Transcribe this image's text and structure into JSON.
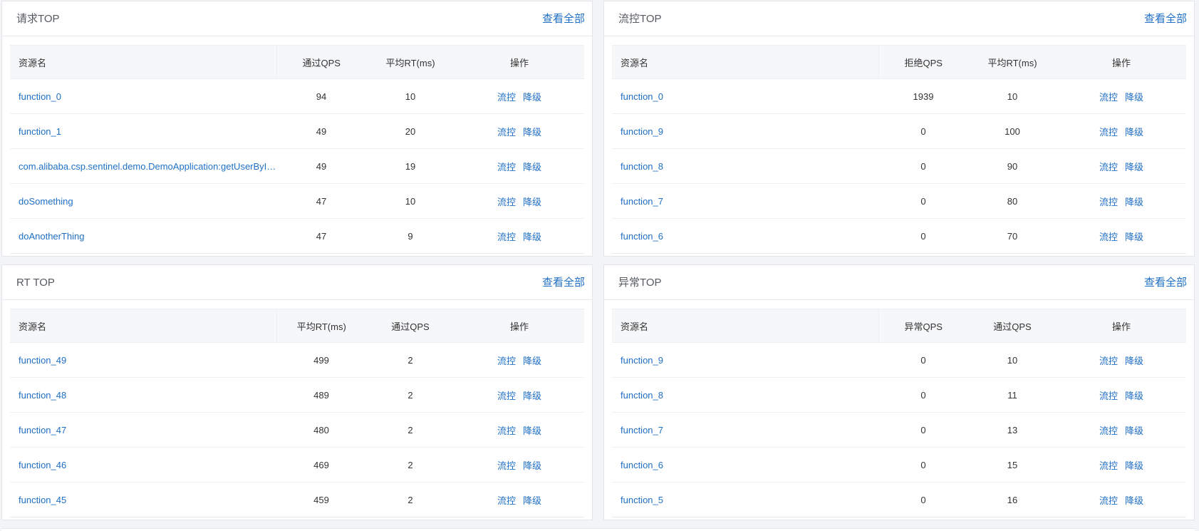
{
  "panels": [
    {
      "title": "请求TOP",
      "view_all": "查看全部",
      "columns": [
        "资源名",
        "通过QPS",
        "平均RT(ms)",
        "操作"
      ],
      "rows": [
        {
          "name": "function_0",
          "c1": "94",
          "c2": "10"
        },
        {
          "name": "function_1",
          "c1": "49",
          "c2": "20"
        },
        {
          "name": "com.alibaba.csp.sentinel.demo.DemoApplication:getUserById(java.l...",
          "c1": "49",
          "c2": "19"
        },
        {
          "name": "doSomething",
          "c1": "47",
          "c2": "10"
        },
        {
          "name": "doAnotherThing",
          "c1": "47",
          "c2": "9"
        }
      ]
    },
    {
      "title": "流控TOP",
      "view_all": "查看全部",
      "columns": [
        "资源名",
        "拒绝QPS",
        "平均RT(ms)",
        "操作"
      ],
      "rows": [
        {
          "name": "function_0",
          "c1": "1939",
          "c2": "10"
        },
        {
          "name": "function_9",
          "c1": "0",
          "c2": "100"
        },
        {
          "name": "function_8",
          "c1": "0",
          "c2": "90"
        },
        {
          "name": "function_7",
          "c1": "0",
          "c2": "80"
        },
        {
          "name": "function_6",
          "c1": "0",
          "c2": "70"
        }
      ]
    },
    {
      "title": "RT TOP",
      "view_all": "查看全部",
      "columns": [
        "资源名",
        "平均RT(ms)",
        "通过QPS",
        "操作"
      ],
      "rows": [
        {
          "name": "function_49",
          "c1": "499",
          "c2": "2"
        },
        {
          "name": "function_48",
          "c1": "489",
          "c2": "2"
        },
        {
          "name": "function_47",
          "c1": "480",
          "c2": "2"
        },
        {
          "name": "function_46",
          "c1": "469",
          "c2": "2"
        },
        {
          "name": "function_45",
          "c1": "459",
          "c2": "2"
        }
      ]
    },
    {
      "title": "异常TOP",
      "view_all": "查看全部",
      "columns": [
        "资源名",
        "异常QPS",
        "通过QPS",
        "操作"
      ],
      "rows": [
        {
          "name": "function_9",
          "c1": "0",
          "c2": "10"
        },
        {
          "name": "function_8",
          "c1": "0",
          "c2": "11"
        },
        {
          "name": "function_7",
          "c1": "0",
          "c2": "13"
        },
        {
          "name": "function_6",
          "c1": "0",
          "c2": "15"
        },
        {
          "name": "function_5",
          "c1": "0",
          "c2": "16"
        }
      ]
    }
  ],
  "actions": {
    "flow": "流控",
    "degrade": "降级"
  },
  "colors": {
    "link": "#1f6fc5",
    "header_bg": "#f6f7f9",
    "border": "#e3e6ea"
  }
}
